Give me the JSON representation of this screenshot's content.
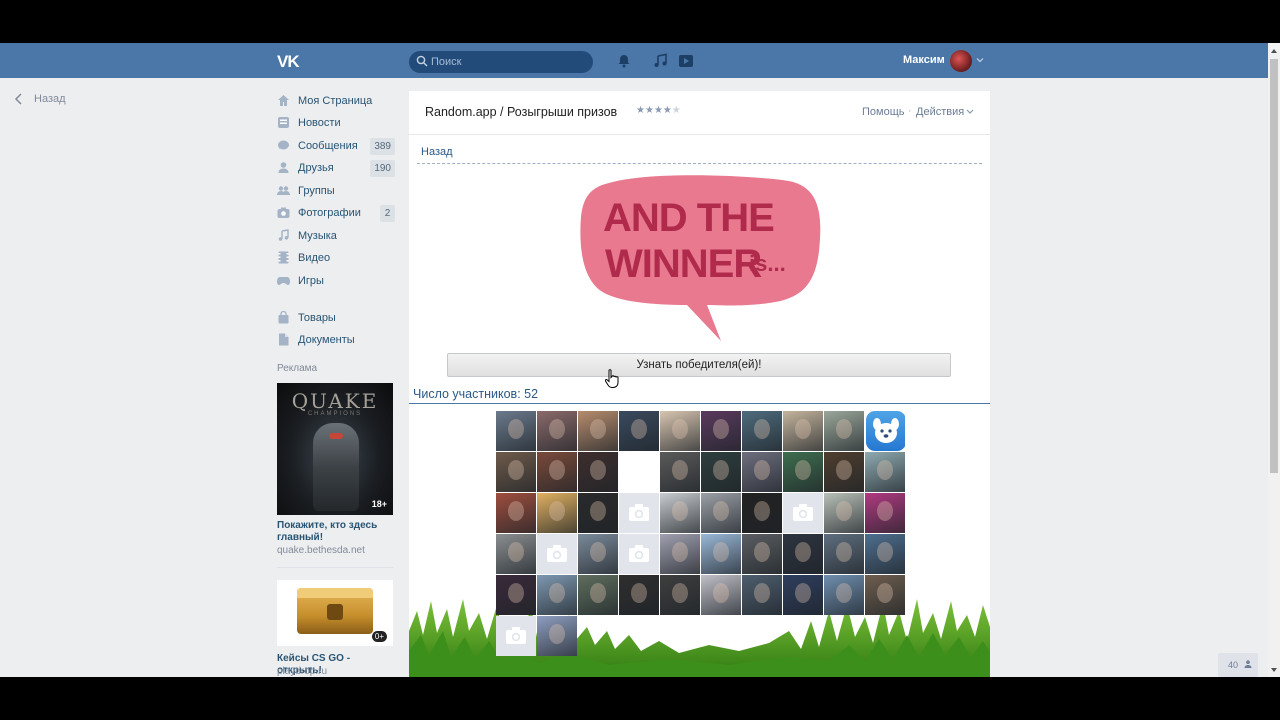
{
  "header": {
    "logo": "VK",
    "search_placeholder": "Поиск",
    "user_name": "Максим"
  },
  "back_left": "Назад",
  "sidebar": {
    "items": [
      {
        "label": "Моя Страница",
        "icon": "home-icon",
        "badge": ""
      },
      {
        "label": "Новости",
        "icon": "news-icon",
        "badge": ""
      },
      {
        "label": "Сообщения",
        "icon": "messages-icon",
        "badge": "389"
      },
      {
        "label": "Друзья",
        "icon": "friends-icon",
        "badge": "190"
      },
      {
        "label": "Группы",
        "icon": "groups-icon",
        "badge": ""
      },
      {
        "label": "Фотографии",
        "icon": "photos-icon",
        "badge": "2"
      },
      {
        "label": "Музыка",
        "icon": "music-icon",
        "badge": ""
      },
      {
        "label": "Видео",
        "icon": "video-icon",
        "badge": ""
      },
      {
        "label": "Игры",
        "icon": "games-icon",
        "badge": ""
      },
      {
        "label": "Товары",
        "icon": "goods-icon",
        "badge": ""
      },
      {
        "label": "Документы",
        "icon": "documents-icon",
        "badge": ""
      }
    ],
    "ads_label": "Реклама",
    "ad1": {
      "image_title": "QUAKE",
      "image_subtitle": "CHAMPIONS",
      "age": "18+",
      "title": "Покажите, кто здесь главный!",
      "domain": "quake.bethesda.net"
    },
    "ad2": {
      "age": "0+",
      "title": "Кейсы CS GO - открыть!",
      "domain": "playdrop.ru"
    }
  },
  "app": {
    "title": "Random.app / Розыгрыши призов",
    "rating": 4,
    "rating_max": 5,
    "help": "Помощь",
    "separator": "·",
    "actions": "Действия",
    "back": "Назад",
    "bubble_line1": "AND THE",
    "bubble_line2": "WINNER",
    "bubble_line3": "is...",
    "button": "Узнать победителя(ей)!",
    "participants": "Число участников: 52"
  },
  "participants_grid": {
    "count": 52,
    "columns": 10,
    "colors": [
      "#6b7a8c",
      "#8a6a6a",
      "#b58c6d",
      "#3a4a5e",
      "#d8c5b0",
      "#5a3a5e",
      "#4e6c7d",
      "#c4b49c",
      "#9aa79a",
      "vk",
      "#6e5a4a",
      "#7a4a3a",
      "#3e2e2e",
      "empty",
      "#5a5a5a",
      "#2e3e3e",
      "#6e6e7e",
      "#3e6e4e",
      "#4e3e2e",
      "#8eaab0",
      "#9e4e3e",
      "#e0b060",
      "#2a2a2a",
      "nophoto",
      "#c8ccd0",
      "#9aa0a6",
      "#222222",
      "nophoto",
      "#b8c0b8",
      "#b03a80",
      "#8a8e90",
      "nophoto",
      "#7a8a9a",
      "nophoto",
      "#a0a0b0",
      "#9ab8d8",
      "#5a5e62",
      "#2e3440",
      "#5e6e7e",
      "#4e6e8e",
      "#3a2a3a",
      "#7e98b0",
      "#5e6e5e",
      "#2e2e2e",
      "#3e3e3e",
      "#c0c0c8",
      "#4e5e6e",
      "#2e3e5e",
      "#6e8eae",
      "#6e5e4e",
      "nophoto",
      "#8e9ec0"
    ]
  },
  "footer": {
    "count": "40"
  }
}
